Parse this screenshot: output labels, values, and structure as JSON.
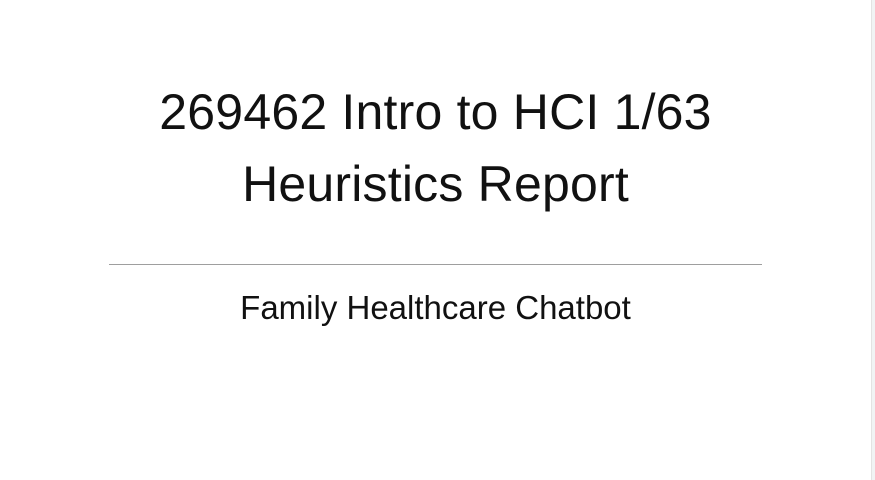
{
  "slide": {
    "title_line1": "269462 Intro to HCI 1/63",
    "title_line2": "Heuristics Report",
    "subtitle": "Family Healthcare Chatbot"
  },
  "colors": {
    "text": "#111111",
    "divider": "#9e9e9e",
    "background": "#ffffff"
  }
}
